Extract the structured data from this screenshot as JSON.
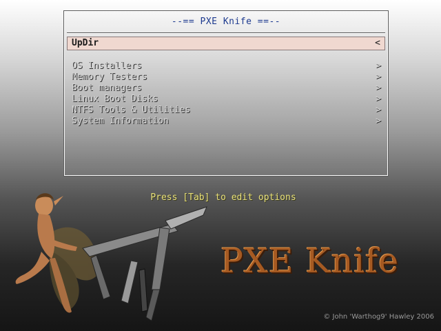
{
  "menu": {
    "title": "--== PXE Knife ==--",
    "updir": {
      "label": "UpDir",
      "arrow": "<"
    },
    "items": [
      {
        "label": "OS Installers",
        "arrow": ">"
      },
      {
        "label": "Memory Testers",
        "arrow": ">"
      },
      {
        "label": "Boot managers",
        "arrow": ">"
      },
      {
        "label": "Linux Boot Disks",
        "arrow": ">"
      },
      {
        "label": "NTFS Tools & Utilities",
        "arrow": ">"
      },
      {
        "label": "System Information",
        "arrow": ">"
      }
    ]
  },
  "hint": "Press [Tab] to edit options",
  "branding": {
    "logo_text": "PXE Knife",
    "copyright": "© John 'Warthog9' Hawley 2006"
  },
  "colors": {
    "title": "#1d3a8f",
    "selected_row": "#f0d8d0",
    "hint": "#e8e07a",
    "logo": "#a65a22"
  },
  "icons": {
    "illustration": "fairy-with-multitool"
  }
}
